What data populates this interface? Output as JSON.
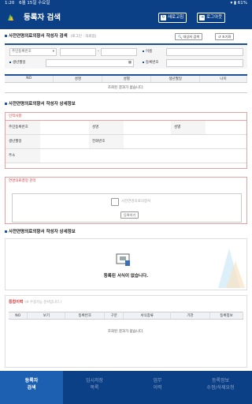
{
  "statusbar": {
    "time": "1:20",
    "date": "6월 15일 수요일",
    "icons": "▾ ▮ 61%"
  },
  "header": {
    "title": "등록자 검색",
    "refresh_label": "새로고침",
    "logout_label": "로그아웃"
  },
  "search": {
    "title": "사전연명의료의향서 작성자 검색",
    "subtitle": "(로그인 : 의뢰업)",
    "advanced_button": "대상자 검색",
    "reset_button": "초기화",
    "id_type_label": "주민등록번호",
    "name_label": "이름",
    "birth_label": "생년월일",
    "reg_no_label": "등록번호"
  },
  "result_table": {
    "columns": [
      "NO",
      "성명",
      "성별",
      "생년월일",
      "나이"
    ],
    "empty_message": "조회된 결과가 없습니다."
  },
  "detail": {
    "title": "사전연명의료의향서 작성자 상세정보",
    "person_header": "인적사항",
    "fields": [
      "주민등록번호",
      "성명",
      "성별",
      "생년월일",
      "전화번호",
      "주소"
    ],
    "signature_header": "연명의료결정 관리",
    "signature_placeholder": "사전연명의료의향서",
    "signature_button": "등록하기"
  },
  "detail2": {
    "title": "사전연명의료의향서 작성자 상세정보",
    "message": "등록된 서식이 없습니다."
  },
  "history": {
    "title": "통합이력",
    "note": "(※ 수정가능 문서입니다.)",
    "columns": [
      "NO",
      "보기",
      "등록번호",
      "구분",
      "서식종류",
      "기관",
      "등록정보"
    ],
    "empty_message": "조회된 결과가 없습니다."
  },
  "tabs": [
    {
      "line1": "등록자",
      "line2": "검색"
    },
    {
      "line1": "임시저장",
      "line2": "목록"
    },
    {
      "line1": "업무",
      "line2": "이력"
    },
    {
      "line1": "등록정보",
      "line2": "수정/삭제요청"
    }
  ],
  "colors": {
    "primary": "#0b3f86",
    "active_tab": "#1d5fb0",
    "accent_red": "#d04040"
  }
}
